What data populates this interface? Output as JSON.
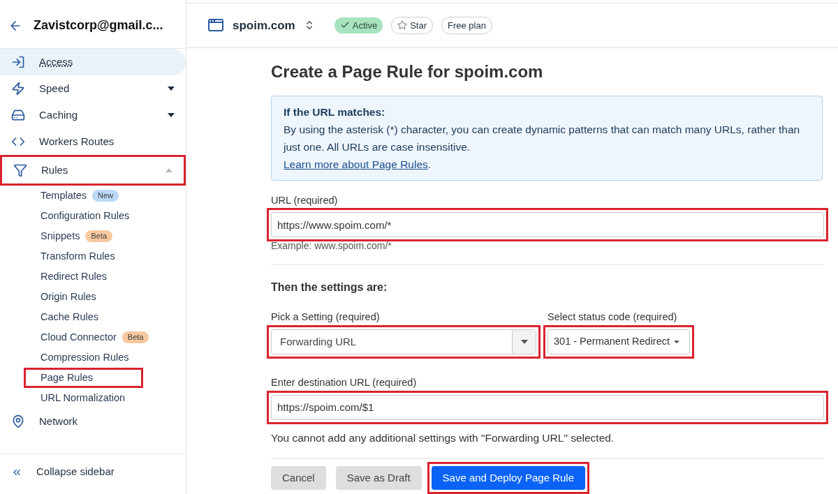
{
  "sidebar": {
    "account": "Zavistcorp@gmail.c...",
    "items": [
      {
        "label": "Access",
        "selected": true,
        "highlighted": false
      },
      {
        "label": "Speed",
        "selected": false,
        "expanded": false,
        "highlighted": false
      },
      {
        "label": "Caching",
        "selected": false,
        "expanded": false,
        "highlighted": false
      },
      {
        "label": "Workers Routes",
        "selected": false,
        "highlighted": false
      },
      {
        "label": "Rules",
        "selected": false,
        "expanded": true,
        "highlighted": true,
        "children": [
          {
            "label": "Templates",
            "badge": "New",
            "color": "#bcd9f7",
            "highlighted": false
          },
          {
            "label": "Configuration Rules",
            "highlighted": false
          },
          {
            "label": "Snippets",
            "badge": "Beta",
            "color": "#f7c9a0",
            "highlighted": false
          },
          {
            "label": "Transform Rules",
            "highlighted": false
          },
          {
            "label": "Redirect Rules",
            "highlighted": false
          },
          {
            "label": "Origin Rules",
            "highlighted": false
          },
          {
            "label": "Cache Rules",
            "highlighted": false
          },
          {
            "label": "Cloud Connector",
            "badge": "Beta",
            "color": "#f7c9a0",
            "highlighted": false
          },
          {
            "label": "Compression Rules",
            "highlighted": false
          },
          {
            "label": "Page Rules",
            "highlighted": true
          },
          {
            "label": "URL Normalization",
            "highlighted": false
          }
        ]
      },
      {
        "label": "Network",
        "selected": false,
        "highlighted": false
      }
    ],
    "collapse": "Collapse sidebar"
  },
  "header": {
    "domain": "spoim.com",
    "status": "Active",
    "star": "Star",
    "plan": "Free plan"
  },
  "title": "Create a Page Rule for spoim.com",
  "info": {
    "heading": "If the URL matches:",
    "text": "By using the asterisk (*) character, you can create dynamic patterns that can match many URLs, rather than just one. All URLs are case insensitive.",
    "link": "Learn more about Page Rules",
    "after_link": "."
  },
  "url": {
    "label": "URL (required)",
    "value": "https://www.spoim.com/*",
    "hint": "Example: www.spoim.com/*",
    "highlighted": true
  },
  "settings_heading": "Then the settings are:",
  "setting": {
    "label": "Pick a Setting (required)",
    "value": "Forwarding URL",
    "highlighted": true
  },
  "status_code": {
    "label": "Select status code (required)",
    "value": "301 - Permanent Redirect",
    "highlighted": true
  },
  "destination": {
    "label": "Enter destination URL (required)",
    "value": "https://spoim.com/$1",
    "highlighted": true
  },
  "note": "You cannot add any additional settings with \"Forwarding URL\" selected.",
  "buttons": [
    {
      "label": "Cancel",
      "kind": "secondary",
      "highlighted": false
    },
    {
      "label": "Save as Draft",
      "kind": "secondary",
      "highlighted": false
    },
    {
      "label": "Save and Deploy Page Rule",
      "kind": "primary",
      "highlighted": true
    }
  ]
}
